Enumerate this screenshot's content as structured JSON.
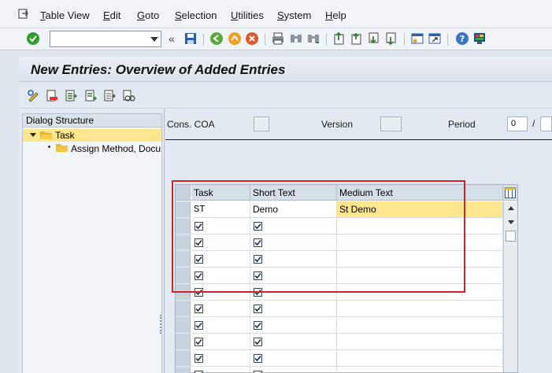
{
  "menu": {
    "items": [
      {
        "label": "Table View",
        "u": "T",
        "rest": "able View"
      },
      {
        "label": "Edit",
        "u": "E",
        "rest": "dit"
      },
      {
        "label": "Goto",
        "u": "G",
        "rest": "oto"
      },
      {
        "label": "Selection",
        "u": "S",
        "rest": "election"
      },
      {
        "label": "Utilities",
        "u": "U",
        "rest": "tilities"
      },
      {
        "label": "System",
        "u": "S",
        "rest": "ystem"
      },
      {
        "label": "Help",
        "u": "H",
        "rest": "elp"
      }
    ]
  },
  "toolbar": {
    "command_field": {
      "value": "",
      "placeholder": ""
    },
    "icons": [
      "enter-icon",
      "back-nav-icon",
      "save-icon",
      "back-icon",
      "exit-icon",
      "cancel-icon",
      "print-icon",
      "find-icon",
      "find-next-icon",
      "first-page-icon",
      "previous-page-icon",
      "next-page-icon",
      "last-page-icon",
      "create-session-icon",
      "shortcut-icon",
      "help-icon",
      "layout-icon"
    ]
  },
  "title": "New Entries: Overview of Added Entries",
  "dialog_structure": {
    "header": "Dialog Structure",
    "items": [
      {
        "label": "Task",
        "selected": true,
        "expanded": true
      },
      {
        "label": "Assign Method, Docu",
        "selected": false
      }
    ]
  },
  "filters": {
    "cons_coa_label": "Cons. COA",
    "cons_coa_value": "",
    "version_label": "Version",
    "version_value": "",
    "period_label": "Period",
    "period_value": "0",
    "period_separator": "/",
    "year_value": ""
  },
  "table": {
    "columns": [
      "Task",
      "Short Text",
      "Medium Text"
    ],
    "rows": [
      {
        "task": "ST",
        "short_text": "Demo",
        "medium_text": "St Demo",
        "task_checked": false,
        "short_checked": false
      },
      {
        "task": "",
        "short_text": "",
        "medium_text": "",
        "task_checked": true,
        "short_checked": true
      },
      {
        "task": "",
        "short_text": "",
        "medium_text": "",
        "task_checked": true,
        "short_checked": true
      },
      {
        "task": "",
        "short_text": "",
        "medium_text": "",
        "task_checked": true,
        "short_checked": true
      },
      {
        "task": "",
        "short_text": "",
        "medium_text": "",
        "task_checked": true,
        "short_checked": true
      },
      {
        "task": "",
        "short_text": "",
        "medium_text": "",
        "task_checked": true,
        "short_checked": true
      },
      {
        "task": "",
        "short_text": "",
        "medium_text": "",
        "task_checked": true,
        "short_checked": true
      },
      {
        "task": "",
        "short_text": "",
        "medium_text": "",
        "task_checked": true,
        "short_checked": true
      },
      {
        "task": "",
        "short_text": "",
        "medium_text": "",
        "task_checked": true,
        "short_checked": true
      },
      {
        "task": "",
        "short_text": "",
        "medium_text": "",
        "task_checked": true,
        "short_checked": true
      },
      {
        "task": "",
        "short_text": "",
        "medium_text": "",
        "task_checked": true,
        "short_checked": true
      }
    ]
  },
  "colors": {
    "highlight": "#fde68d",
    "annotation_red": "#c9252a",
    "enter_green": "#2e9e2e"
  }
}
